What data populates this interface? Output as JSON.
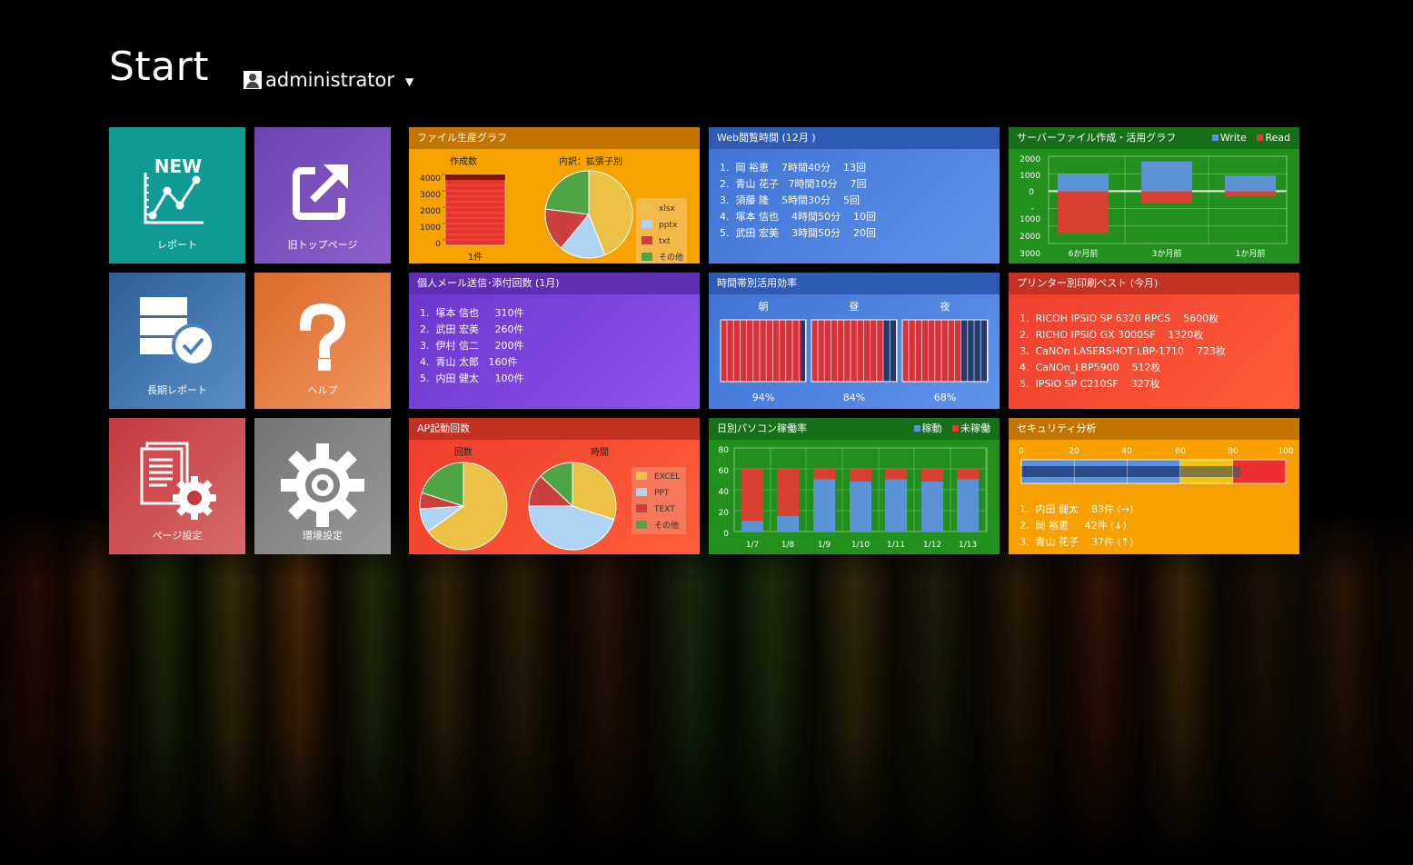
{
  "header": {
    "title": "Start",
    "user_name": "administrator",
    "user_caret": "▼"
  },
  "menu_tiles": [
    {
      "label": "レポート",
      "icon": "new-report-chart-icon",
      "badge": "NEW",
      "color": "#0f9a94"
    },
    {
      "label": "旧トップページ",
      "icon": "external-link-icon",
      "color": "#7e52bd"
    },
    {
      "label": "長期レポート",
      "icon": "server-clock-icon",
      "color": "#3a6eaa"
    },
    {
      "label": "ヘルプ",
      "icon": "question-mark-icon",
      "color": "#e1733a"
    },
    {
      "label": "ページ設定",
      "icon": "document-gear-icon",
      "color": "#c43e42"
    },
    {
      "label": "環境設定",
      "icon": "gear-icon",
      "color": "#7e7e7e"
    }
  ],
  "file_production": {
    "title": "ファイル生産グラフ",
    "count_title": "作成数",
    "count_axis": [
      "4000",
      "3000",
      "2000",
      "1000",
      "0"
    ],
    "count_label": "1件",
    "breakdown_title": "内訳：拡張子別",
    "legend": [
      "xlsx",
      "pptx",
      "txt",
      "その他"
    ]
  },
  "web_browsing": {
    "title": "Web閲覧時間 (12月 )",
    "items": [
      "1.  岡 裕恵    7時間40分    13回",
      "2.  青山 花子   7時間10分    7回",
      "3.  須藤 隆    5時間30分    5回",
      "4.  塚本 信也    4時間50分    10回",
      "5.  武田 宏美    3時間50分    20回"
    ]
  },
  "server_file": {
    "title": "サーバーファイル作成・活用グラフ",
    "legend": [
      "Write",
      "Read"
    ],
    "y_ticks": [
      "2000",
      "1000",
      "0",
      "-",
      "1000",
      "2000",
      "3000"
    ],
    "categories": [
      "6か月前",
      "3か月前",
      "1か月前"
    ]
  },
  "personal_mail": {
    "title": "個人メール送信･添付回数 (1月)",
    "items": [
      "1.  塚本 信也     310件",
      "2.  武田 宏美     260件",
      "3.  伊村 信二     200件",
      "4.  青山 太郎   160件",
      "5.  内田 健太     100件"
    ]
  },
  "time_efficiency": {
    "title": "時間帯別活用効率",
    "slots": [
      {
        "label": "朝",
        "percent": "94%"
      },
      {
        "label": "昼",
        "percent": "84%"
      },
      {
        "label": "夜",
        "percent": "68%"
      }
    ]
  },
  "printer": {
    "title": "プリンター別印刷ベスト (今月)",
    "items": [
      "1.  RICOH IPSiO SP 6320 RPCS    5600枚",
      "2.  RICHO IPSiO GX 3000SF    1320枚",
      "3.  CaNOn LASERSHOT LBP-1710    723枚",
      "4.  CaNOn_LBP5900    512枚",
      "5.  IPSiO SP C210SF    327枚"
    ]
  },
  "ap_launch": {
    "title": "AP起動回数",
    "left_title": "回数",
    "right_title": "時間",
    "legend": [
      "EXCEL",
      "PPT",
      "TEXT",
      "その他"
    ]
  },
  "daily_pc": {
    "title": "日別パソコン稼働率",
    "legend": [
      "稼動",
      "未稼働"
    ],
    "y_ticks": [
      "80",
      "60",
      "40",
      "20",
      "0"
    ],
    "categories": [
      "1/7",
      "1/8",
      "1/9",
      "1/10",
      "1/11",
      "1/12",
      "1/13"
    ]
  },
  "security": {
    "title": "セキュリティ分析",
    "scale": [
      "0",
      "20",
      "40",
      "60",
      "80",
      "100"
    ],
    "items": [
      "1.  内田 健太    83件 (→)",
      "2.  岡 裕恵     42件 (↓)",
      "3.  青山 花子    37件 (↑)"
    ]
  },
  "chart_data": [
    {
      "type": "bar",
      "title": "作成数",
      "categories": [
        "1件"
      ],
      "values": [
        4000
      ],
      "ylim": [
        0,
        4000
      ]
    },
    {
      "type": "pie",
      "title": "内訳：拡張子別",
      "labels": [
        "xlsx",
        "pptx",
        "txt",
        "その他"
      ],
      "values": [
        44,
        17,
        16,
        23
      ],
      "colors": [
        "#ecc246",
        "#afd3f3",
        "#cc3f3f",
        "#4ea545"
      ]
    },
    {
      "type": "bar",
      "title": "",
      "categories": [
        "6か月前",
        "3か月前",
        "1か月前"
      ],
      "series": [
        {
          "name": "Write",
          "values": [
            1000,
            1700,
            900
          ],
          "color": "#5b93d6"
        },
        {
          "name": "Read",
          "values": [
            -2400,
            -700,
            -300
          ],
          "color": "#d84032"
        }
      ],
      "ylim": [
        -3000,
        2000
      ]
    },
    {
      "type": "bar",
      "title": "時間帯別活用効率",
      "categories": [
        "朝",
        "昼",
        "夜"
      ],
      "values": [
        94,
        84,
        68
      ],
      "ylim": [
        0,
        100
      ]
    },
    {
      "type": "pie",
      "title": "回数",
      "labels": [
        "EXCEL",
        "PPT",
        "TEXT",
        "その他"
      ],
      "values": [
        65,
        9,
        6,
        20
      ],
      "colors": [
        "#ecc246",
        "#afd3f3",
        "#cc3f3f",
        "#4ea545"
      ]
    },
    {
      "type": "pie",
      "title": "時間",
      "labels": [
        "EXCEL",
        "PPT",
        "TEXT",
        "その他"
      ],
      "values": [
        30,
        45,
        12,
        13
      ],
      "colors": [
        "#ecc246",
        "#afd3f3",
        "#cc3f3f",
        "#4ea545"
      ]
    },
    {
      "type": "bar",
      "title": "",
      "categories": [
        "1/7",
        "1/8",
        "1/9",
        "1/10",
        "1/11",
        "1/12",
        "1/13"
      ],
      "series": [
        {
          "name": "稼動",
          "values": [
            10,
            15,
            50,
            48,
            50,
            48,
            50
          ],
          "color": "#5b93d6"
        },
        {
          "name": "未稼働",
          "values": [
            50,
            45,
            10,
            12,
            10,
            12,
            10
          ],
          "color": "#d84032"
        }
      ],
      "ylim": [
        0,
        80
      ]
    },
    {
      "type": "bar",
      "title": "",
      "categories": [
        "1",
        "2"
      ],
      "values": [
        60,
        83
      ],
      "xlim": [
        0,
        100
      ]
    }
  ]
}
